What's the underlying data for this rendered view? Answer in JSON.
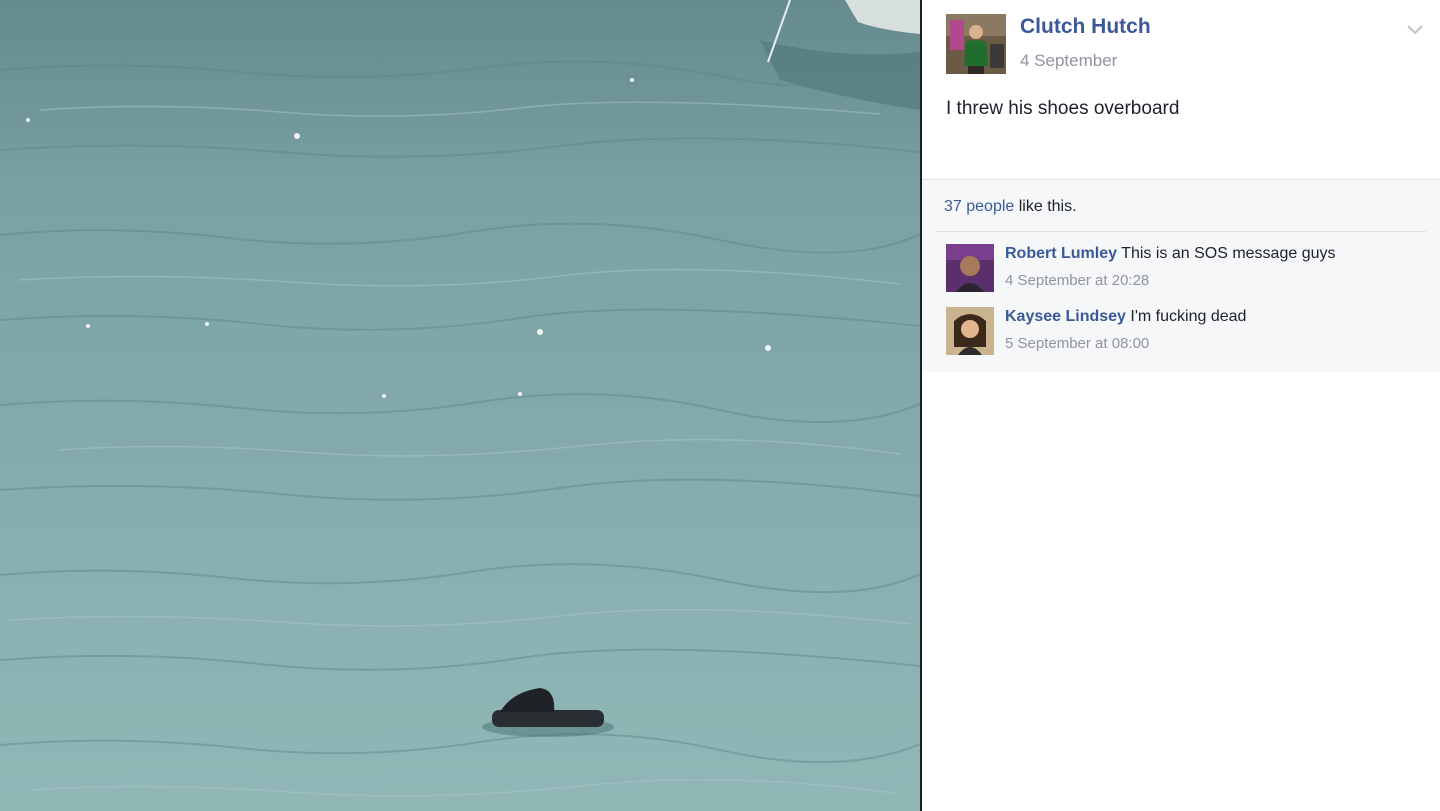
{
  "post": {
    "author_name": "Clutch Hutch",
    "date": "4 September",
    "text": "I threw his shoes overboard",
    "menu_icon": "chevron-down-icon"
  },
  "feedback": {
    "likes_link": "37 people",
    "likes_suffix": " like this."
  },
  "comments": [
    {
      "author": "Robert Lumley",
      "text": "This is an SOS message guys",
      "time": "4 September at 20:28"
    },
    {
      "author": "Kaysee Lindsey",
      "text": "I'm fucking dead",
      "time": "5 September at 08:00"
    }
  ],
  "colors": {
    "link": "#3b5998",
    "meta": "#90949c",
    "feedback_bg": "#f6f7f9",
    "water": "#84aaac"
  }
}
